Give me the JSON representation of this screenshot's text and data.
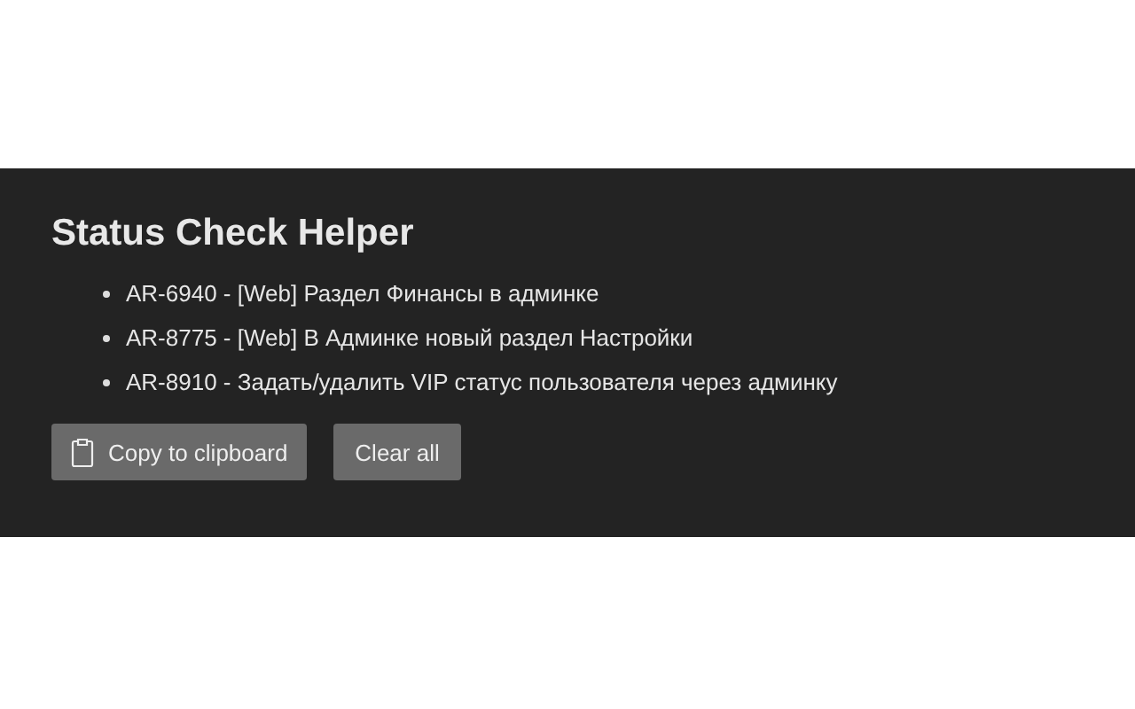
{
  "title": "Status Check Helper",
  "items": [
    {
      "text": "AR-6940 - [Web] Раздел Финансы в админке"
    },
    {
      "text": "AR-8775 - [Web] В Админке новый раздел Настройки"
    },
    {
      "text": "AR-8910 - Задать/удалить VIP статус пользователя через админку"
    }
  ],
  "buttons": [
    {
      "kind": "copy",
      "label": "Copy to clipboard"
    },
    {
      "kind": "clear",
      "label": "Clear all"
    }
  ]
}
